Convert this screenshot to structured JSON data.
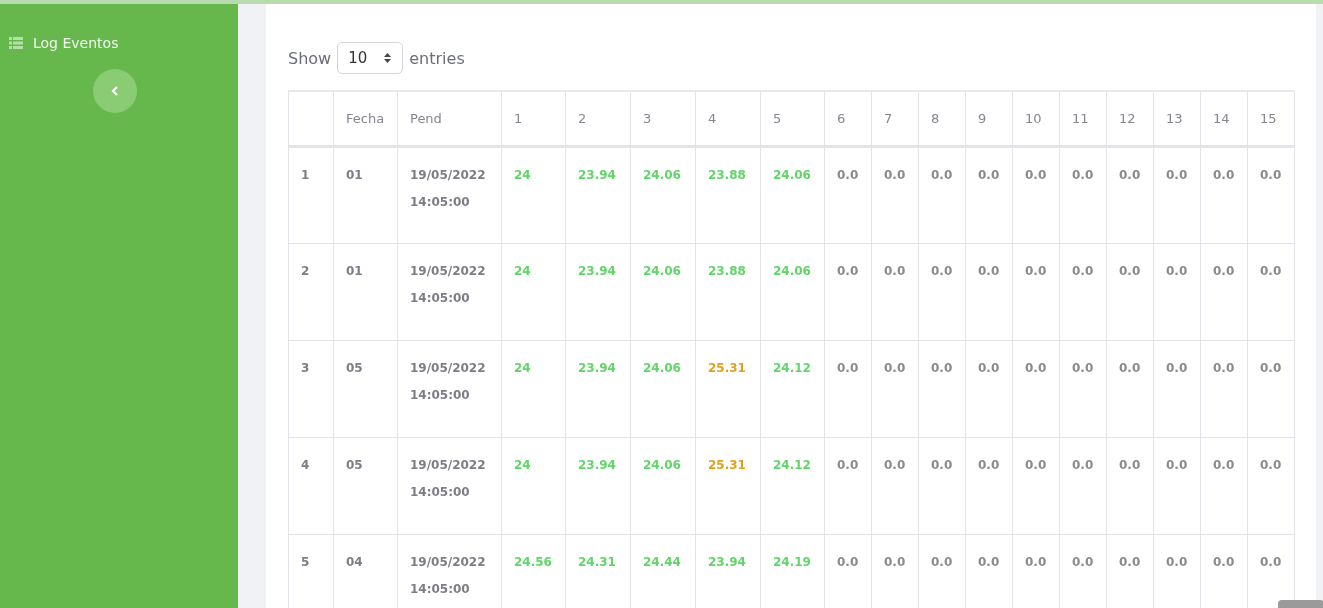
{
  "sidebar": {
    "items": [
      {
        "label": "Log Eventos"
      }
    ]
  },
  "length_control": {
    "prefix": "Show",
    "value": "10",
    "suffix": "entries"
  },
  "table": {
    "columns": [
      "",
      "Fecha",
      "Pend",
      "1",
      "2",
      "3",
      "4",
      "5",
      "6",
      "7",
      "8",
      "9",
      "10",
      "11",
      "12",
      "13",
      "14",
      "15"
    ],
    "rows": [
      {
        "cells": [
          "1",
          "01",
          "19/05/2022 14:05:00"
        ],
        "values": [
          {
            "text": "24",
            "color": "#5fd667"
          },
          {
            "text": "23.94",
            "color": "#5fd667"
          },
          {
            "text": "24.06",
            "color": "#5fd667"
          },
          {
            "text": "23.88",
            "color": "#5fd667"
          },
          {
            "text": "24.06",
            "color": "#5fd667"
          },
          {
            "text": "0.0",
            "color": "#8a8a8e"
          },
          {
            "text": "0.0",
            "color": "#8a8a8e"
          },
          {
            "text": "0.0",
            "color": "#8a8a8e"
          },
          {
            "text": "0.0",
            "color": "#8a8a8e"
          },
          {
            "text": "0.0",
            "color": "#8a8a8e"
          },
          {
            "text": "0.0",
            "color": "#8a8a8e"
          },
          {
            "text": "0.0",
            "color": "#8a8a8e"
          },
          {
            "text": "0.0",
            "color": "#8a8a8e"
          },
          {
            "text": "0.0",
            "color": "#8a8a8e"
          },
          {
            "text": "0.0",
            "color": "#8a8a8e"
          }
        ]
      },
      {
        "cells": [
          "2",
          "01",
          "19/05/2022 14:05:00"
        ],
        "values": [
          {
            "text": "24",
            "color": "#5fd667"
          },
          {
            "text": "23.94",
            "color": "#5fd667"
          },
          {
            "text": "24.06",
            "color": "#5fd667"
          },
          {
            "text": "23.88",
            "color": "#5fd667"
          },
          {
            "text": "24.06",
            "color": "#5fd667"
          },
          {
            "text": "0.0",
            "color": "#8a8a8e"
          },
          {
            "text": "0.0",
            "color": "#8a8a8e"
          },
          {
            "text": "0.0",
            "color": "#8a8a8e"
          },
          {
            "text": "0.0",
            "color": "#8a8a8e"
          },
          {
            "text": "0.0",
            "color": "#8a8a8e"
          },
          {
            "text": "0.0",
            "color": "#8a8a8e"
          },
          {
            "text": "0.0",
            "color": "#8a8a8e"
          },
          {
            "text": "0.0",
            "color": "#8a8a8e"
          },
          {
            "text": "0.0",
            "color": "#8a8a8e"
          },
          {
            "text": "0.0",
            "color": "#8a8a8e"
          }
        ]
      },
      {
        "cells": [
          "3",
          "05",
          "19/05/2022 14:05:00"
        ],
        "values": [
          {
            "text": "24",
            "color": "#5fd667"
          },
          {
            "text": "23.94",
            "color": "#5fd667"
          },
          {
            "text": "24.06",
            "color": "#5fd667"
          },
          {
            "text": "25.31",
            "color": "#e0a020"
          },
          {
            "text": "24.12",
            "color": "#5fd667"
          },
          {
            "text": "0.0",
            "color": "#8a8a8e"
          },
          {
            "text": "0.0",
            "color": "#8a8a8e"
          },
          {
            "text": "0.0",
            "color": "#8a8a8e"
          },
          {
            "text": "0.0",
            "color": "#8a8a8e"
          },
          {
            "text": "0.0",
            "color": "#8a8a8e"
          },
          {
            "text": "0.0",
            "color": "#8a8a8e"
          },
          {
            "text": "0.0",
            "color": "#8a8a8e"
          },
          {
            "text": "0.0",
            "color": "#8a8a8e"
          },
          {
            "text": "0.0",
            "color": "#8a8a8e"
          },
          {
            "text": "0.0",
            "color": "#8a8a8e"
          }
        ]
      },
      {
        "cells": [
          "4",
          "05",
          "19/05/2022 14:05:00"
        ],
        "values": [
          {
            "text": "24",
            "color": "#5fd667"
          },
          {
            "text": "23.94",
            "color": "#5fd667"
          },
          {
            "text": "24.06",
            "color": "#5fd667"
          },
          {
            "text": "25.31",
            "color": "#e0a020"
          },
          {
            "text": "24.12",
            "color": "#5fd667"
          },
          {
            "text": "0.0",
            "color": "#8a8a8e"
          },
          {
            "text": "0.0",
            "color": "#8a8a8e"
          },
          {
            "text": "0.0",
            "color": "#8a8a8e"
          },
          {
            "text": "0.0",
            "color": "#8a8a8e"
          },
          {
            "text": "0.0",
            "color": "#8a8a8e"
          },
          {
            "text": "0.0",
            "color": "#8a8a8e"
          },
          {
            "text": "0.0",
            "color": "#8a8a8e"
          },
          {
            "text": "0.0",
            "color": "#8a8a8e"
          },
          {
            "text": "0.0",
            "color": "#8a8a8e"
          },
          {
            "text": "0.0",
            "color": "#8a8a8e"
          }
        ]
      },
      {
        "cells": [
          "5",
          "04",
          "19/05/2022 14:05:00"
        ],
        "values": [
          {
            "text": "24.56",
            "color": "#5fd667"
          },
          {
            "text": "24.31",
            "color": "#5fd667"
          },
          {
            "text": "24.44",
            "color": "#5fd667"
          },
          {
            "text": "23.94",
            "color": "#5fd667"
          },
          {
            "text": "24.19",
            "color": "#5fd667"
          },
          {
            "text": "0.0",
            "color": "#8a8a8e"
          },
          {
            "text": "0.0",
            "color": "#8a8a8e"
          },
          {
            "text": "0.0",
            "color": "#8a8a8e"
          },
          {
            "text": "0.0",
            "color": "#8a8a8e"
          },
          {
            "text": "0.0",
            "color": "#8a8a8e"
          },
          {
            "text": "0.0",
            "color": "#8a8a8e"
          },
          {
            "text": "0.0",
            "color": "#8a8a8e"
          },
          {
            "text": "0.0",
            "color": "#8a8a8e"
          },
          {
            "text": "0.0",
            "color": "#8a8a8e"
          },
          {
            "text": "0.0",
            "color": "#8a8a8e"
          }
        ]
      }
    ]
  }
}
